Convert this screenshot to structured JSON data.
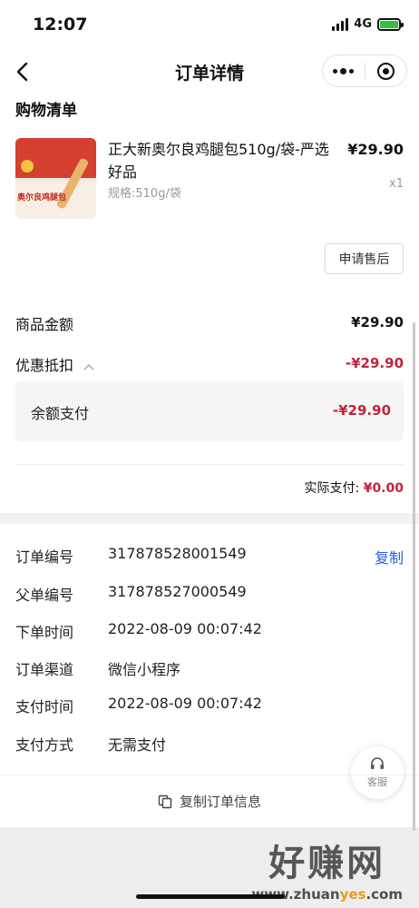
{
  "status_bar": {
    "time": "12:07",
    "network": "4G"
  },
  "nav": {
    "title": "订单详情"
  },
  "shopping_list": {
    "title": "购物清单",
    "item": {
      "name": "正大新奥尔良鸡腿包510g/袋-严选好品",
      "spec": "规格:510g/袋",
      "price": "¥29.90",
      "qty": "x1",
      "thumb_text": "奥尔良鸡腿包"
    },
    "aftersale_label": "申请售后"
  },
  "amounts": {
    "goods_label": "商品金额",
    "goods_value": "¥29.90",
    "discount_label": "优惠抵扣",
    "discount_value": "-¥29.90",
    "balance_label": "余额支付",
    "balance_value": "-¥29.90",
    "actual_label": "实际支付:",
    "actual_value": "¥0.00",
    "accent_color": "#c3243a"
  },
  "order_info": {
    "rows": [
      {
        "label": "订单编号",
        "value": "317878528001549"
      },
      {
        "label": "父单编号",
        "value": "317878527000549"
      },
      {
        "label": "下单时间",
        "value": "2022-08-09 00:07:42"
      },
      {
        "label": "订单渠道",
        "value": "微信小程序"
      },
      {
        "label": "支付时间",
        "value": "2022-08-09 00:07:42"
      },
      {
        "label": "支付方式",
        "value": "无需支付"
      }
    ],
    "copy_label": "复制",
    "copy_color": "#2a61d6"
  },
  "service": {
    "label": "客服"
  },
  "copy_order": {
    "label": "复制订单信息"
  },
  "watermark": {
    "big": "好赚网",
    "small_prefix": "www.zhuan",
    "small_highlight": "yes",
    "small_suffix": ".com"
  }
}
